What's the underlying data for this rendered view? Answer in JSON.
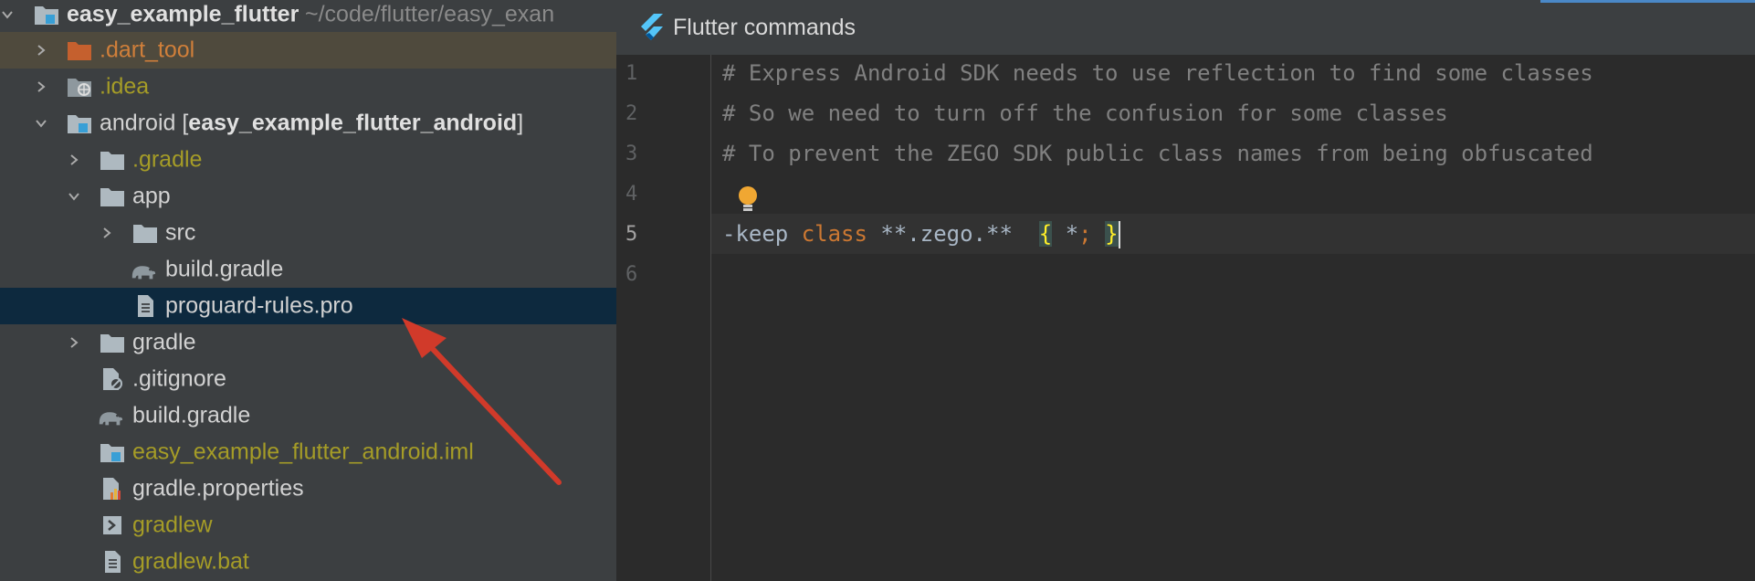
{
  "tree": {
    "items": [
      {
        "label": "easy_example_flutter",
        "path": " ~/code/flutter/easy_exan",
        "expanded": true,
        "icon": "module-folder-icon"
      },
      {
        "label": ".dart_tool",
        "expanded": false,
        "icon": "folder-icon"
      },
      {
        "label": ".idea",
        "expanded": false,
        "icon": "idea-folder-icon"
      },
      {
        "label": "android [",
        "module": "easy_example_flutter_android",
        "suffix": "]",
        "expanded": true,
        "icon": "module-folder-icon"
      },
      {
        "label": ".gradle",
        "expanded": false,
        "icon": "folder-icon"
      },
      {
        "label": "app",
        "expanded": true,
        "icon": "folder-icon"
      },
      {
        "label": "src",
        "expanded": false,
        "icon": "folder-icon"
      },
      {
        "label": "build.gradle",
        "icon": "gradle-elephant-icon"
      },
      {
        "label": "proguard-rules.pro",
        "icon": "text-file-icon",
        "selected": true
      },
      {
        "label": "gradle",
        "expanded": false,
        "icon": "folder-icon"
      },
      {
        "label": ".gitignore",
        "icon": "ignored-file-icon"
      },
      {
        "label": "build.gradle",
        "icon": "gradle-elephant-icon"
      },
      {
        "label": "easy_example_flutter_android.iml",
        "icon": "iml-file-icon"
      },
      {
        "label": "gradle.properties",
        "icon": "properties-file-icon"
      },
      {
        "label": "gradlew",
        "icon": "shell-script-icon"
      },
      {
        "label": "gradlew.bat",
        "icon": "text-file-icon"
      }
    ]
  },
  "editor": {
    "title": "Flutter commands",
    "title_icon": "flutter-icon",
    "line_numbers": [
      "1",
      "2",
      "3",
      "4",
      "5",
      "6"
    ],
    "lines": {
      "l1": "# Express Android SDK needs to use reflection to find some classes",
      "l2": "# So we need to turn off the confusion for some classes",
      "l3": "# To prevent the ZEGO SDK public class names from being obfuscated",
      "l5_a": "-keep ",
      "l5_kw": "class",
      "l5_b": " **.zego.**  ",
      "l5_open": "{",
      "l5_mid": " *",
      "l5_semi": ";",
      "l5_sp": " ",
      "l5_close": "}"
    },
    "current_line": "5"
  },
  "colors": {
    "tree_bg": "#3c3f41",
    "selection": "#0d293e",
    "excluded_row": "#4f4a3d",
    "editor_bg": "#2b2b2b",
    "comment": "#808080",
    "keyword": "#cc7832",
    "olive_text": "#a59c27",
    "arrow": "#d13a2a"
  }
}
